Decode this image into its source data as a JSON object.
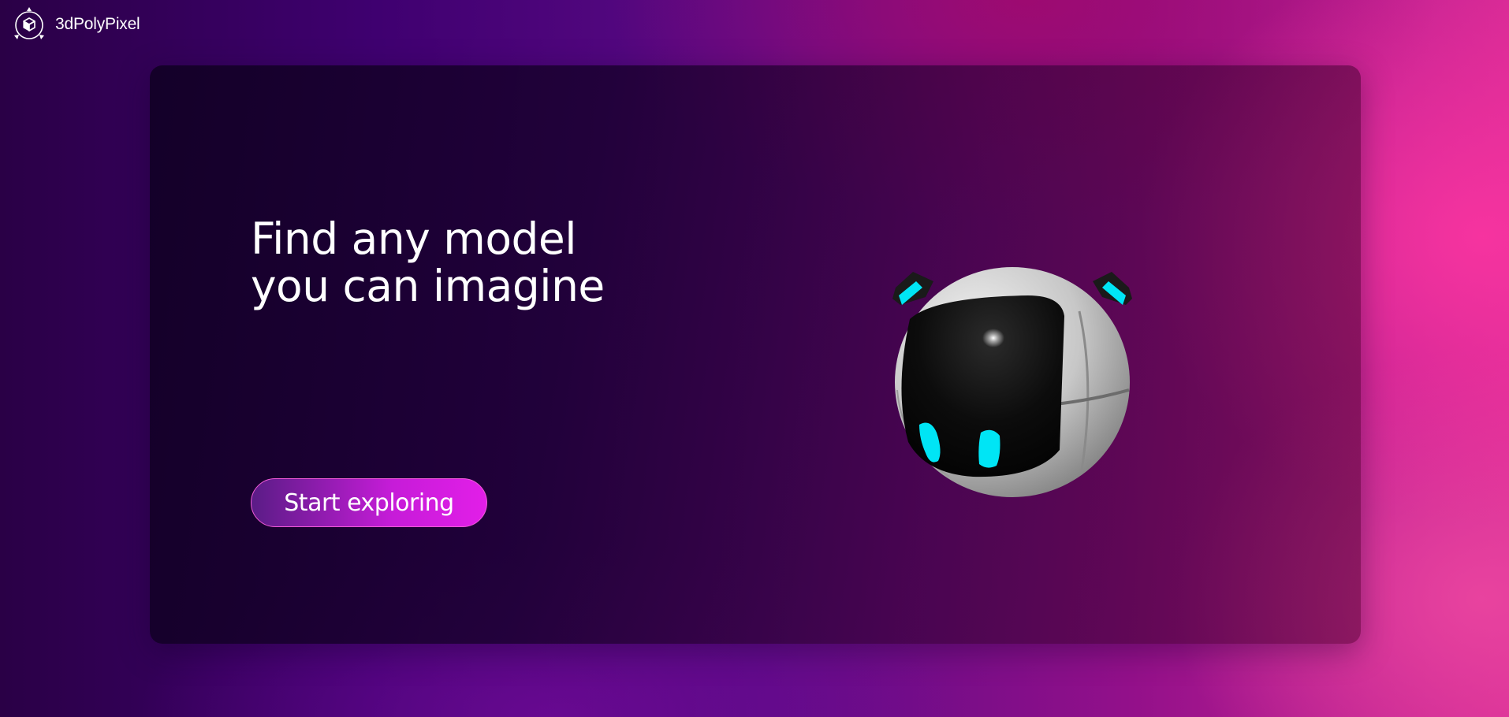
{
  "brand": {
    "name": "3dPolyPixel",
    "logo_icon": "cube-orbit-logo-icon"
  },
  "hero": {
    "title_line1": "Find any model",
    "title_line2": "you can imagine",
    "cta_label": "Start exploring",
    "model_icon": "robot-head-3d-model"
  },
  "colors": {
    "card_bg": "#160028",
    "cta_gradient_start": "#5a1c86",
    "cta_gradient_end": "#e21ee8",
    "robot_accent": "#00e5f5"
  }
}
